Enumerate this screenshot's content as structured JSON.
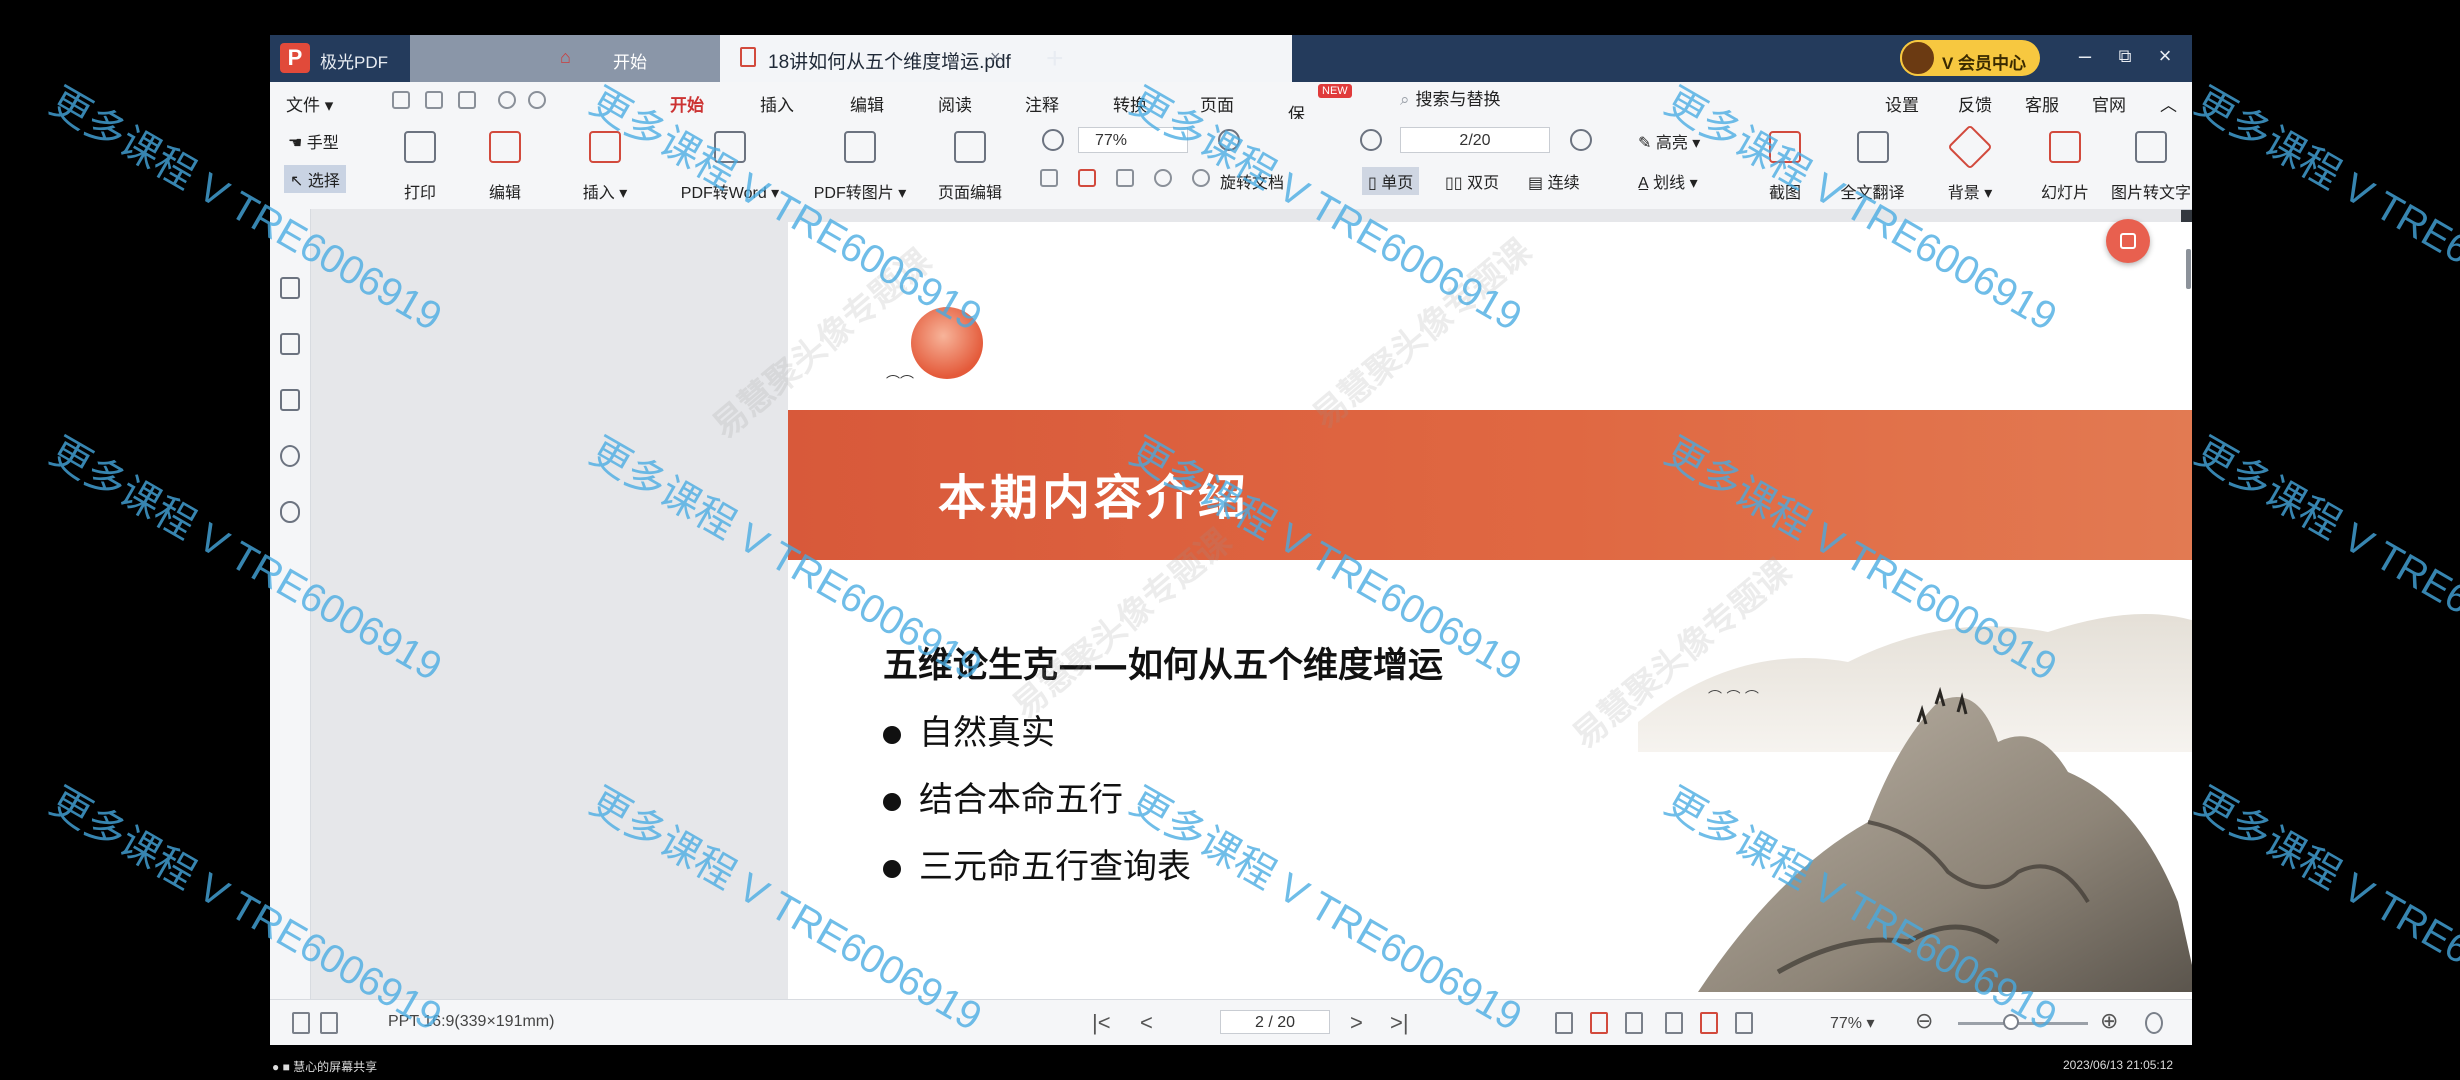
{
  "window": {
    "app_name": "极光PDF",
    "tabs": [
      {
        "label": "开始",
        "close": "×"
      },
      {
        "label": "18讲如何从五个维度增运.pdf",
        "close": "×"
      }
    ],
    "add_tab": "+",
    "vip_label": "V 会员中心",
    "controls": {
      "minimize": "–",
      "restore": "⧉",
      "close": "×"
    }
  },
  "menubar": {
    "file": "文件 ▾",
    "items": [
      "开始",
      "插入",
      "编辑",
      "阅读",
      "注释",
      "转换",
      "页面",
      "保护"
    ],
    "new_badge": "NEW",
    "search_placeholder": "搜索与替换",
    "right_items": [
      "设置",
      "反馈",
      "客服",
      "官网"
    ],
    "collapse": "︿"
  },
  "toolbar": {
    "hand": "手型",
    "select": "选择",
    "print": "打印",
    "edit": "编辑",
    "insert": "插入 ▾",
    "pdf_to_word": "PDF转Word ▾",
    "pdf_to_image": "PDF转图片 ▾",
    "page_edit": "页面编辑",
    "zoom": "77%",
    "rotate_doc": "旋转文档",
    "page_indicator": "2/20",
    "single_page": "单页",
    "double_page": "双页",
    "continuous": "连续",
    "highlight": "高亮 ▾",
    "strikethrough": "划线 ▾",
    "screenshot": "截图",
    "full_translate": "全文翻译",
    "background": "背景 ▾",
    "slideshow": "幻灯片",
    "image_to_text": "图片转文字"
  },
  "slide": {
    "banner_title": "本期内容介绍",
    "subtitle": "五维论生克——如何从五个维度增运",
    "bullets": [
      "自然真实",
      "结合本命五行",
      "三元命五行查询表"
    ],
    "colors": {
      "banner": "#e06842",
      "sun": "#e45a3a"
    }
  },
  "statusbar": {
    "page_size": "PPT 16:9(339×191mm)",
    "page_nav": "2 / 20",
    "zoom": "77% ▾",
    "nav_first": "|<",
    "nav_prev": "<",
    "nav_next": ">",
    "nav_last": ">|",
    "zoom_out": "⊖",
    "zoom_in": "⊕"
  },
  "watermarks": {
    "overlay": "更多课程 V TRE6006919",
    "background": "易慧聚头像专题课"
  },
  "taskbar": {
    "left": "● ■ 慧心的屏幕共享",
    "right": "2023/06/13 21:05:12"
  }
}
